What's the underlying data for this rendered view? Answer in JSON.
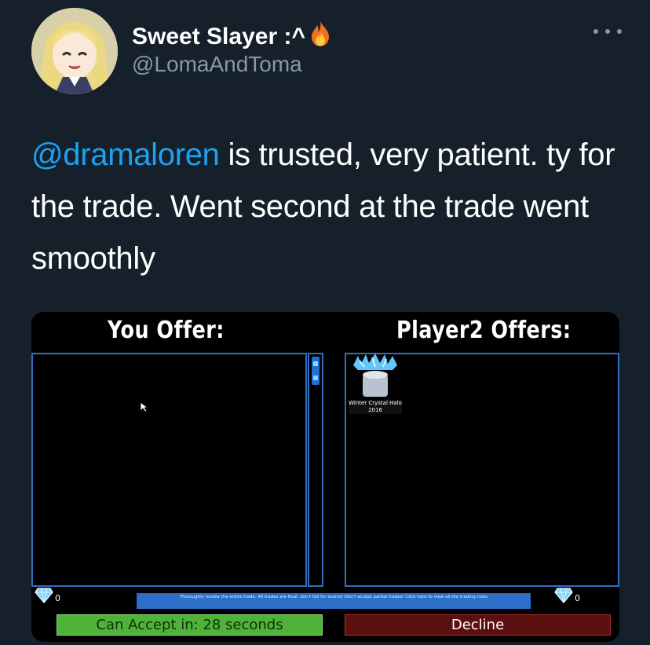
{
  "tweet": {
    "display_name": "Sweet Slayer :^",
    "name_emoji": "fire-emoji",
    "handle": "@LomaAndToma",
    "text_mention": "@dramaloren",
    "text_body": " is trusted, very patient. ty for the trade. Went second at the trade went smoothly",
    "mention_color": "#1da1f2"
  },
  "trade_window": {
    "you_offer_label": "You Offer:",
    "player2_offers_label": "Player2 Offers:",
    "player2_item_name": "Winter Crystal Halo 2016",
    "your_gem_count": "0",
    "player2_gem_count": "0",
    "notice_text": "Thoroughly review the entire trade. All trades are final. don't fall for scams! Don't accept partial trades! Click here to view all the trading rules",
    "accept_label": "Can Accept in: 28 seconds",
    "decline_label": "Decline",
    "colors": {
      "panel_border": "#2f6fbf",
      "accept": "#4fb339",
      "decline": "#5c0f0f",
      "notice": "#2d6ec9"
    }
  }
}
